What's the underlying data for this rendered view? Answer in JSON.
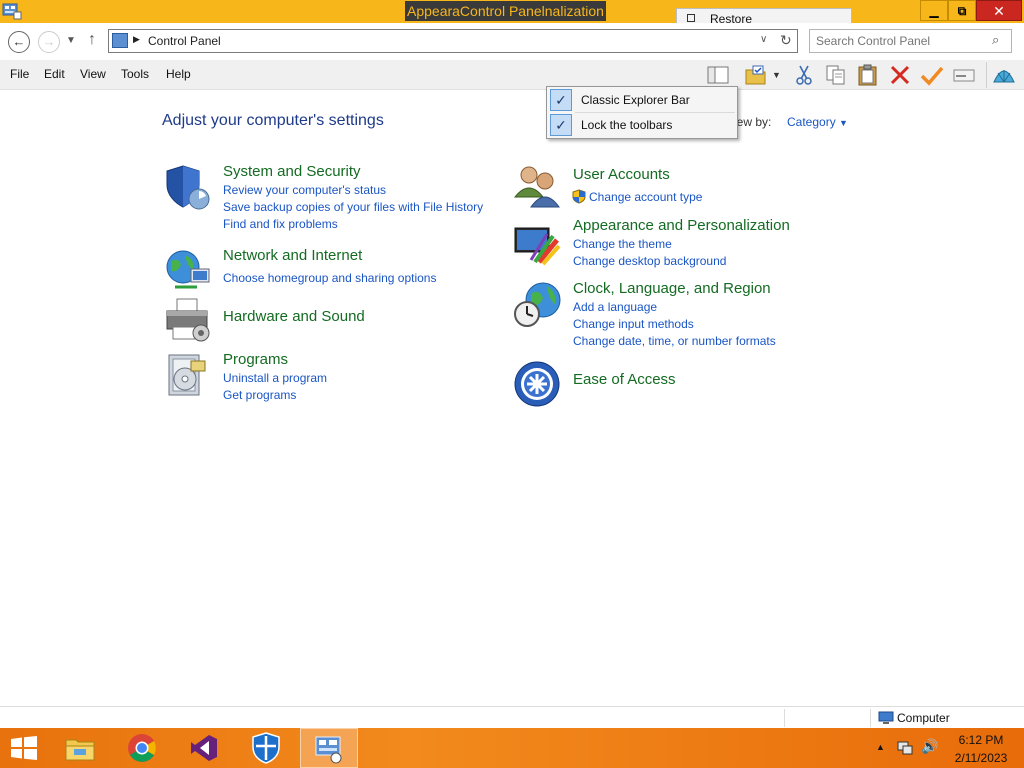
{
  "window": {
    "title": "AppearaControl Panelnalization",
    "restore_label": "Restore",
    "controls": {
      "minimize_icon": "minimize-icon",
      "maximize_icon": "maximize-icon",
      "close_icon": "close-icon"
    }
  },
  "address": {
    "path": "Control Panel",
    "search_placeholder": "Search Control Panel"
  },
  "menu": {
    "items": [
      "File",
      "Edit",
      "View",
      "Tools",
      "Help"
    ]
  },
  "toolbar": {
    "icons": [
      "layout-icon",
      "folder-options-icon",
      "dropdown-icon",
      "cut-icon",
      "copy-icon",
      "paste-icon",
      "delete-icon",
      "check-icon",
      "properties-icon",
      "shell-icon"
    ]
  },
  "context_menu": {
    "items": [
      {
        "label": "Classic Explorer Bar",
        "checked": true
      },
      {
        "label": "Lock the toolbars",
        "checked": true
      }
    ]
  },
  "content": {
    "heading": "Adjust your computer's settings",
    "view_by_label": "iew by:",
    "view_by_value": "Category",
    "left_categories": [
      {
        "title": "System and Security",
        "icon": "security-shield-icon",
        "links": [
          "Review your computer's status",
          "Save backup copies of your files with File History",
          "Find and fix problems"
        ]
      },
      {
        "title": "Network and Internet",
        "icon": "network-globe-icon",
        "links": [
          "Choose homegroup and sharing options"
        ]
      },
      {
        "title": "Hardware and Sound",
        "icon": "printer-icon",
        "links": []
      },
      {
        "title": "Programs",
        "icon": "programs-icon",
        "links": [
          "Uninstall a program",
          "Get programs"
        ]
      }
    ],
    "right_categories": [
      {
        "title": "User Accounts",
        "icon": "users-icon",
        "links": [
          "Change account type"
        ]
      },
      {
        "title": "Appearance and Personalization",
        "icon": "appearance-icon",
        "links": [
          "Change the theme",
          "Change desktop background"
        ]
      },
      {
        "title": "Clock, Language, and Region",
        "icon": "clock-globe-icon",
        "links": [
          "Add a language",
          "Change input methods",
          "Change date, time, or number formats"
        ]
      },
      {
        "title": "Ease of Access",
        "icon": "ease-of-access-icon",
        "links": []
      }
    ]
  },
  "statusbar": {
    "location": "Computer"
  },
  "taskbar": {
    "apps": [
      "start-icon",
      "file-explorer-icon",
      "chrome-icon",
      "visual-studio-icon",
      "defender-icon",
      "control-panel-icon"
    ],
    "active_app": "control-panel-icon"
  },
  "clock": {
    "time": "6:12 PM",
    "date": "2/11/2023"
  },
  "colors": {
    "titlebar": "#f7b71b",
    "taskbar": "#f28a1d",
    "category_title": "#146b22",
    "link": "#1a56c4",
    "heading": "#1e3a8a"
  }
}
